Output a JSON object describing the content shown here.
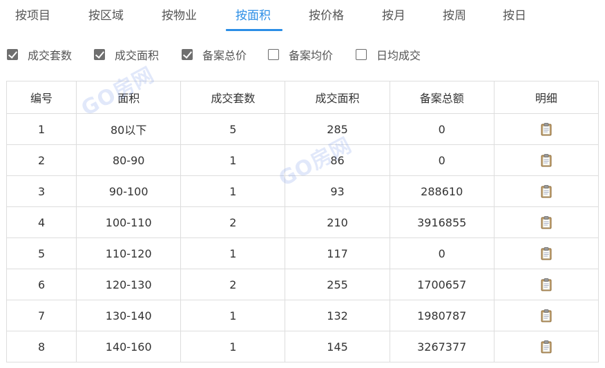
{
  "tabs": [
    {
      "label": "按项目",
      "active": false
    },
    {
      "label": "按区域",
      "active": false
    },
    {
      "label": "按物业",
      "active": false
    },
    {
      "label": "按面积",
      "active": true
    },
    {
      "label": "按价格",
      "active": false
    },
    {
      "label": "按月",
      "active": false
    },
    {
      "label": "按周",
      "active": false
    },
    {
      "label": "按日",
      "active": false
    }
  ],
  "filters": [
    {
      "label": "成交套数",
      "checked": true
    },
    {
      "label": "成交面积",
      "checked": true
    },
    {
      "label": "备案总价",
      "checked": true
    },
    {
      "label": "备案均价",
      "checked": false
    },
    {
      "label": "日均成交",
      "checked": false
    }
  ],
  "table": {
    "headers": [
      "编号",
      "面积",
      "成交套数",
      "成交面积",
      "备案总额",
      "明细"
    ],
    "rows": [
      [
        "1",
        "80以下",
        "5",
        "285",
        "0"
      ],
      [
        "2",
        "80-90",
        "1",
        "86",
        "0"
      ],
      [
        "3",
        "90-100",
        "1",
        "93",
        "288610"
      ],
      [
        "4",
        "100-110",
        "2",
        "210",
        "3916855"
      ],
      [
        "5",
        "110-120",
        "1",
        "117",
        "0"
      ],
      [
        "6",
        "120-130",
        "2",
        "255",
        "1700657"
      ],
      [
        "7",
        "130-140",
        "1",
        "132",
        "1980787"
      ],
      [
        "8",
        "140-160",
        "1",
        "145",
        "3267377"
      ]
    ]
  },
  "watermarks": [
    "GO房网",
    "GO房网",
    "GO房网"
  ],
  "colors": {
    "accent": "#2b8ee6",
    "border": "#dddddd",
    "text": "#333333"
  },
  "icons": {
    "detail": "clipboard-icon"
  }
}
